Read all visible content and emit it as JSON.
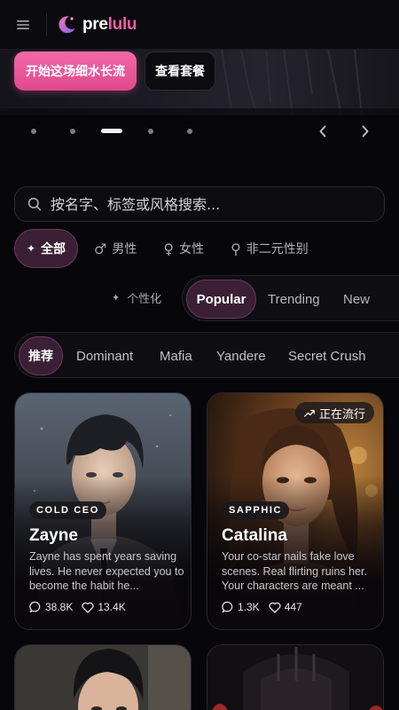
{
  "header": {
    "menu_icon": "hamburger-menu-icon",
    "logo_icon": "crescent-moon-logo-icon",
    "logo_text_white": "pre",
    "logo_text_pink": "lulu",
    "accent": "#ee5ea5"
  },
  "hero": {
    "primary_button": "开始这场细水长流",
    "secondary_button": "查看套餐"
  },
  "carousel": {
    "dot_count": 5,
    "active_index": 2,
    "prev_icon": "chevron-left-icon",
    "next_icon": "chevron-right-icon"
  },
  "search": {
    "placeholder": "按名字、标签或风格搜索...",
    "icon": "search-icon"
  },
  "gender_filters": [
    {
      "label": "全部",
      "icon": "sparkle-icon",
      "active": true
    },
    {
      "label": "男性",
      "icon": "male-icon",
      "active": false
    },
    {
      "label": "女性",
      "icon": "female-icon",
      "active": false
    },
    {
      "label": "非二元性别",
      "icon": "nonbinary-icon",
      "active": false
    }
  ],
  "sort": {
    "personalized_label": "个性化",
    "options": [
      "Popular",
      "Trending",
      "New"
    ],
    "active": "Popular"
  },
  "tags": [
    "推荐",
    "Dominant",
    "Mafia",
    "Yandere",
    "Secret Crush"
  ],
  "cards": [
    {
      "badge": "COLD CEO",
      "name": "Zayne",
      "description": "Zayne has spent years saving lives. He never expected you to become the habit he...",
      "messages": "38.8K",
      "likes": "13.4K"
    },
    {
      "badge": "SAPPHIC",
      "name": "Catalina",
      "description": "Your co-star nails fake love scenes. Real flirting ruins her. Your characters are meant ...",
      "messages": "1.3K",
      "likes": "447",
      "trending_label": "正在流行"
    }
  ]
}
